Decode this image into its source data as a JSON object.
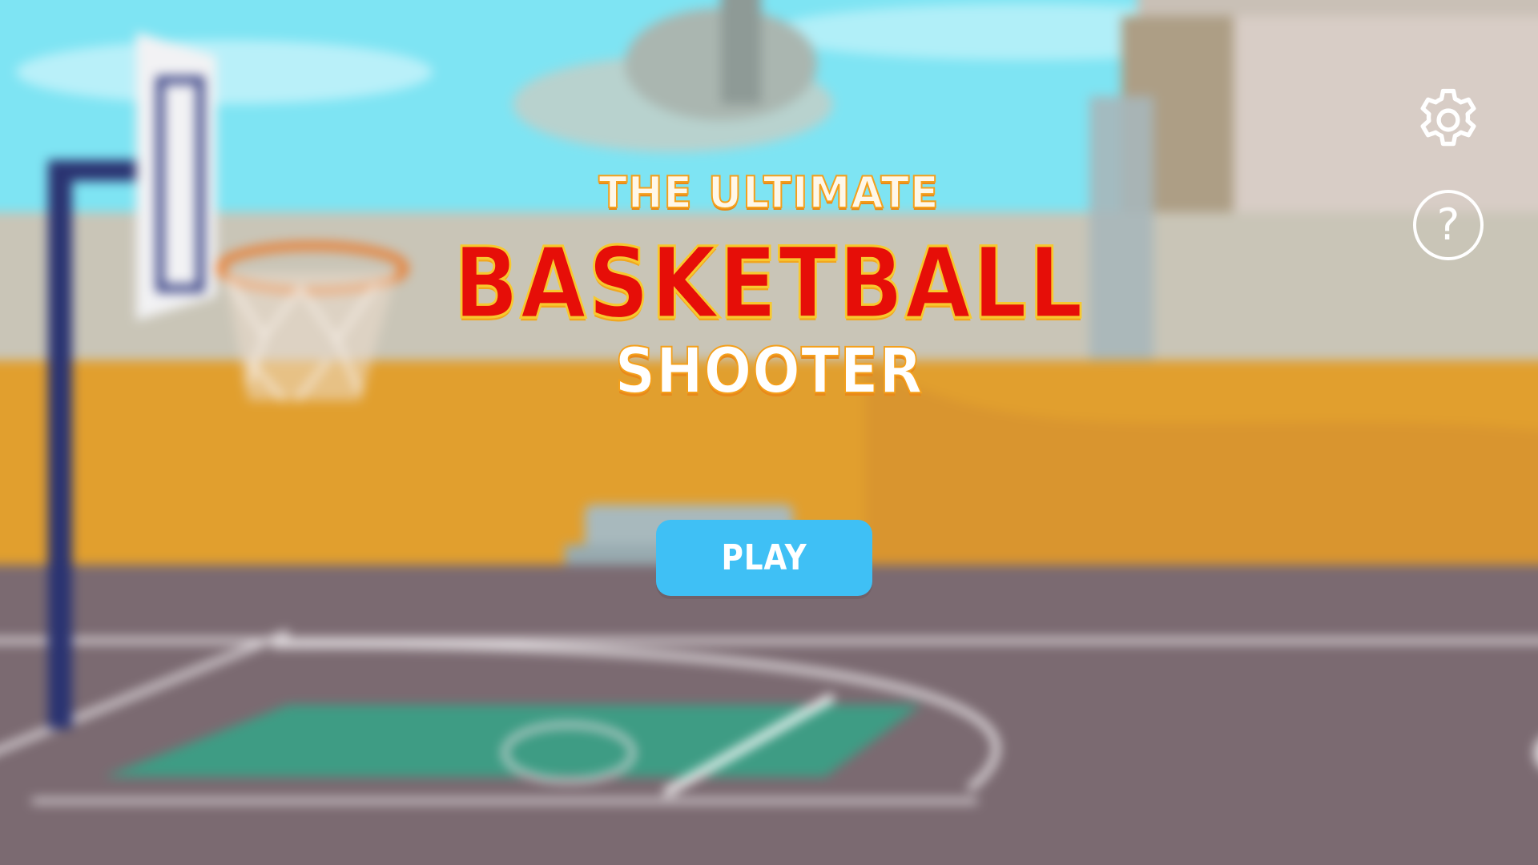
{
  "game": {
    "title_top": "THE ULTIMATE",
    "title_main": "BASKETBALL",
    "title_sub": "SHOOTER"
  },
  "menu": {
    "play_label": "PLAY",
    "settings_icon": "gear-icon",
    "help_icon": "question-mark-icon",
    "help_glyph": "?"
  },
  "colors": {
    "title_main": "#e60e08",
    "title_outline": "#f4a01c",
    "play_button": "#3fc0f5",
    "sky": "#7ee3f2",
    "court": "#7d6b72",
    "wall": "#e09f2e"
  }
}
